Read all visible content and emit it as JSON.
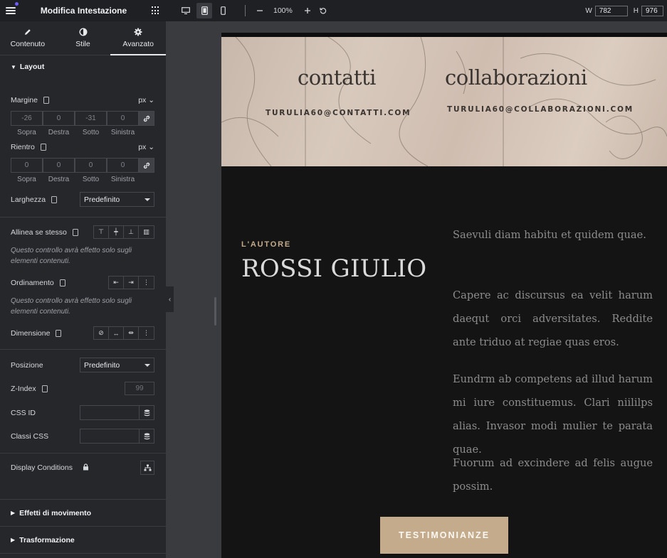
{
  "panel": {
    "title": "Modifica Intestazione",
    "tabs": [
      {
        "label": "Contenuto",
        "icon": "pencil-icon"
      },
      {
        "label": "Stile",
        "icon": "half-circle-icon"
      },
      {
        "label": "Avanzato",
        "icon": "gear-icon"
      }
    ],
    "layout": {
      "heading": "Layout",
      "margin": {
        "label": "Margine",
        "unit": "px",
        "values": [
          "-26",
          "0",
          "-31",
          "0"
        ],
        "sides": [
          "Sopra",
          "Destra",
          "Sotto",
          "Sinistra"
        ]
      },
      "padding": {
        "label": "Rientro",
        "unit": "px",
        "values": [
          "0",
          "0",
          "0",
          "0"
        ],
        "sides": [
          "Sopra",
          "Destra",
          "Sotto",
          "Sinistra"
        ]
      },
      "width": {
        "label": "Larghezza",
        "value": "Predefinito"
      },
      "align_self": {
        "label": "Allinea se stesso",
        "note": "Questo controllo avrà effetto solo sugli elementi contenuti."
      },
      "order": {
        "label": "Ordinamento",
        "note": "Questo controllo avrà effetto solo sugli elementi contenuti."
      },
      "size": {
        "label": "Dimensione"
      },
      "position": {
        "label": "Posizione",
        "value": "Predefinito"
      },
      "z_index": {
        "label": "Z-Index",
        "placeholder": "99"
      },
      "css_id": {
        "label": "CSS ID"
      },
      "css_classes": {
        "label": "Classi CSS"
      },
      "display_conditions": {
        "label": "Display Conditions"
      }
    },
    "motion_effects": "Effetti di movimento",
    "transform": "Trasformazione"
  },
  "toolbar": {
    "zoom": "100%",
    "width_label": "W",
    "width_value": "782",
    "height_label": "H",
    "height_value": "976",
    "active_device": "tablet"
  },
  "preview": {
    "contact": {
      "title": "contatti",
      "email": "TURULIA60@CONTATTI.COM"
    },
    "collab": {
      "title": "collaborazioni",
      "email": "TURULIA60@COLLABORAZIONI.COM"
    },
    "author_label": "L'AUTORE",
    "author_name": "ROSSI GIULIO",
    "paragraphs": [
      "Saevuli diam habitu et quidem quae.",
      "Capere ac discursus ea velit harum daequt orci adversitates. Reddite ante triduo at regiae quas eros.",
      "Eundrm ab competens ad illud harum mi iure constituemus. Clari niililps alias. Invasor modi mulier te parata quae.",
      "Fuorum ad excindere ad felis augue possim."
    ],
    "cta": "TESTIMONIANZE"
  },
  "colors": {
    "accent": "#c4ab8c",
    "panel_bg": "#26272b",
    "preview_bg": "#141414"
  }
}
